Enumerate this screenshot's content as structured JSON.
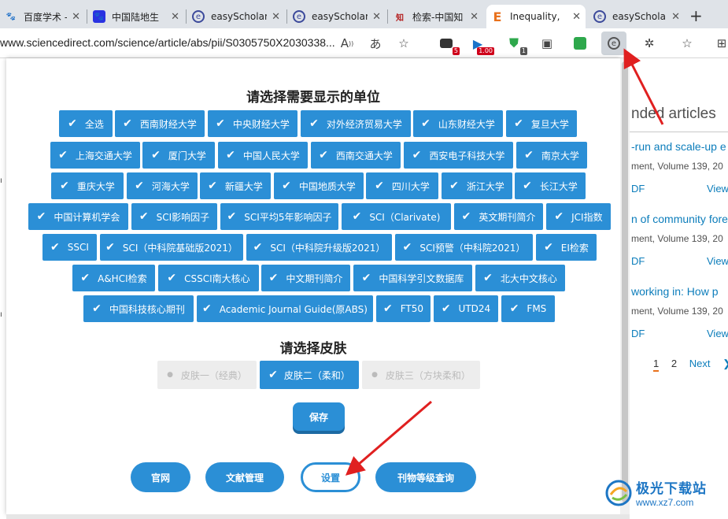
{
  "tabs": [
    {
      "title": "百度学术 - ",
      "fav_icon": "paw-icon",
      "fav_color": "#2932e1"
    },
    {
      "title": "中国陆地生",
      "fav_icon": "paw-icon",
      "fav_color": "#2932e1"
    },
    {
      "title": "easyScholar",
      "fav_icon": "easyscholar-icon",
      "fav_color": "#3c4a9b"
    },
    {
      "title": "easyScholar",
      "fav_icon": "easyscholar-icon",
      "fav_color": "#3c4a9b"
    },
    {
      "title": "检索-中国知",
      "fav_icon": "cnki-icon",
      "fav_color": "#b31b1b"
    },
    {
      "title": "Inequality,",
      "fav_icon": "elsevier-icon",
      "fav_color": "#e9711c"
    },
    {
      "title": "easyScholar",
      "fav_icon": "easyscholar-icon",
      "fav_color": "#3c4a9b"
    }
  ],
  "address": {
    "url": "www.sciencedirect.com/science/article/abs/pii/S0305750X2030338..."
  },
  "toolbar_badges": {
    "ext1": "5",
    "ext2": "1.00",
    "ext3": "1"
  },
  "popup": {
    "units_title": "请选择需要显示的单位",
    "units": [
      [
        "全选",
        "西南财经大学",
        "中央财经大学",
        "对外经济贸易大学",
        "山东财经大学",
        "复旦大学"
      ],
      [
        "上海交通大学",
        "厦门大学",
        "中国人民大学",
        "西南交通大学",
        "西安电子科技大学",
        "南京大学"
      ],
      [
        "重庆大学",
        "河海大学",
        "新疆大学",
        "中国地质大学",
        "四川大学",
        "浙江大学",
        "长江大学"
      ],
      [
        "中国计算机学会",
        "SCI影响因子",
        "SCI平均5年影响因子",
        "SCI（Clarivate)",
        "英文期刊简介",
        "JCI指数"
      ],
      [
        "SSCI",
        "SCI（中科院基础版2021）",
        "SCI（中科院升级版2021）",
        "SCI预警（中科院2021）",
        "EI检索"
      ],
      [
        "A&HCI检索",
        "CSSCI南大核心",
        "中文期刊简介",
        "中国科学引文数据库",
        "北大中文核心"
      ],
      [
        "中国科技核心期刊",
        "Academic Journal Guide(原ABS)",
        "FT50",
        "UTD24",
        "FMS"
      ]
    ],
    "skin_title": "请选择皮肤",
    "skins": [
      "皮肤一（经典）",
      "皮肤二（柔和）",
      "皮肤三（方块柔和）"
    ],
    "selected_skin": "皮肤二（柔和）",
    "save_label": "保存",
    "footer": [
      "官网",
      "文献管理",
      "设置",
      "刊物等级查询"
    ]
  },
  "page": {
    "rec_title": "nded articles",
    "articles": [
      {
        "title": "-run and scale-up e",
        "meta": "ment, Volume 139, 20",
        "pdf": "DF",
        "view": "View"
      },
      {
        "title": "n of community fore",
        "meta": "ment, Volume 139, 20",
        "pdf": "DF",
        "view": "View"
      },
      {
        "title": "working in: How p",
        "meta": "ment, Volume 139, 20",
        "pdf": "DF",
        "view": "View"
      }
    ],
    "pager": {
      "p1": "1",
      "p2": "2",
      "next": "Next"
    }
  },
  "watermark": {
    "main": "极光下载站",
    "sub": "www.xz7.com"
  },
  "colors": {
    "accent": "#2b8fd6",
    "arrow": "#e02020",
    "link": "#0c7dbb"
  }
}
